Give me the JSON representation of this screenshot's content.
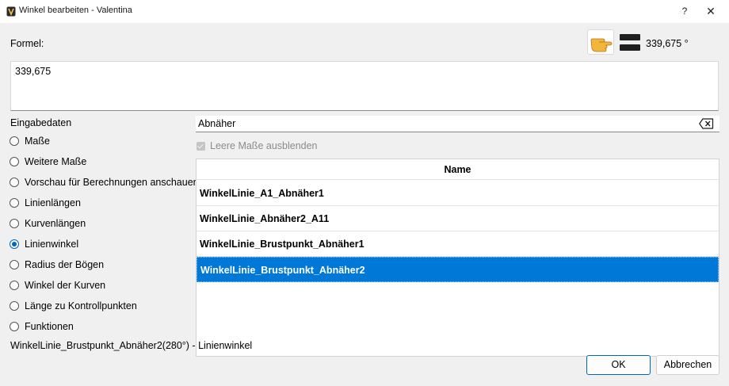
{
  "window": {
    "title": "Winkel bearbeiten - Valentina",
    "help": "?",
    "close": "✕"
  },
  "formula": {
    "label": "Formel:",
    "value": "339,675",
    "result": "339,675 °"
  },
  "input_data": {
    "label": "Eingabedaten",
    "options": [
      {
        "label": "Maße",
        "checked": false
      },
      {
        "label": "Weitere Maße",
        "checked": false
      },
      {
        "label": "Vorschau für Berechnungen anschauen",
        "checked": false
      },
      {
        "label": "Linienlängen",
        "checked": false
      },
      {
        "label": "Kurvenlängen",
        "checked": false
      },
      {
        "label": "Linienwinkel",
        "checked": true
      },
      {
        "label": "Radius der Bögen",
        "checked": false
      },
      {
        "label": "Winkel der Kurven",
        "checked": false
      },
      {
        "label": "Länge zu Kontrollpunkten",
        "checked": false
      },
      {
        "label": "Funktionen",
        "checked": false
      }
    ]
  },
  "search": {
    "value": "Abnäher"
  },
  "hide_empty": {
    "label": "Leere Maße ausblenden",
    "checked": true,
    "enabled": false
  },
  "table": {
    "header": "Name",
    "rows": [
      {
        "name": "WinkelLinie_A1_Abnäher1",
        "selected": false
      },
      {
        "name": "WinkelLinie_Abnäher2_A11",
        "selected": false
      },
      {
        "name": "WinkelLinie_Brustpunkt_Abnäher1",
        "selected": false
      },
      {
        "name": "WinkelLinie_Brustpunkt_Abnäher2",
        "selected": true
      }
    ]
  },
  "status": "WinkelLinie_Brustpunkt_Abnäher2(280°) - Linienwinkel",
  "buttons": {
    "ok": "OK",
    "cancel": "Abbrechen"
  },
  "colors": {
    "accent": "#0078d7",
    "dialog_bg": "#f0f0f0"
  }
}
